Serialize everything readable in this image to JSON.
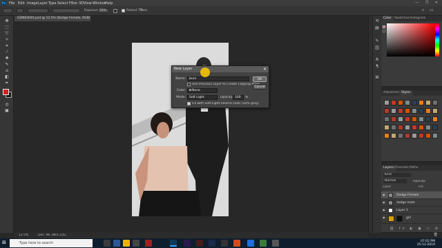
{
  "app": {
    "name": "Photoshop"
  },
  "menubar": {
    "items": [
      "File",
      "Edit",
      "Image",
      "Layer",
      "Type",
      "Select",
      "Filter",
      "3D",
      "View",
      "Window",
      "Help"
    ],
    "window_controls": "— ❐ ✕"
  },
  "options_bar": {
    "label_exposure": "Exposure:",
    "exposure_value": "50%",
    "protect_tones": "Protect Tones"
  },
  "document_tab": {
    "title": "GDN03040.psd @ 12.5% (Dodge Female, RGB/8*) ×"
  },
  "status_bar": {
    "zoom": "12.5%",
    "doc": "Doc: 96.1M/1.22G"
  },
  "dialog": {
    "title": "New Layer",
    "name_label": "Name:",
    "name_value": "burn",
    "clipping_mask": "Use Previous Layer to Create Clipping Mask",
    "color_label": "Color:",
    "color_value": "None",
    "mode_label": "Mode:",
    "mode_value": "Soft Light",
    "opacity_label": "Opacity:",
    "opacity_value": "100",
    "opacity_unit": "%",
    "fill_neutral": "Fill with Soft-Light-neutral color (50% gray)",
    "ok": "OK",
    "cancel": "Cancel"
  },
  "panels": {
    "color_tabs": [
      "Color",
      "Swatches",
      "Histogram"
    ],
    "adjust_tabs": [
      "Adjustments",
      "Styles"
    ],
    "layer_tabs": [
      "Layers",
      "Channels",
      "Paths"
    ],
    "layers_kind": "Kind",
    "blend_mode": "Normal",
    "opacity_label": "Opacity:",
    "fill_label": "Fill:",
    "lock_label": "Lock:"
  },
  "layers": [
    {
      "name": "Dodge Female",
      "selected": true
    },
    {
      "name": "dodge male",
      "selected": false
    },
    {
      "name": "Layer 1",
      "selected": false
    },
    {
      "name": "girl",
      "selected": false
    }
  ],
  "taskbar": {
    "search_placeholder": "Type here to search",
    "time": "07:02 PM",
    "date": "25-12-2019"
  }
}
